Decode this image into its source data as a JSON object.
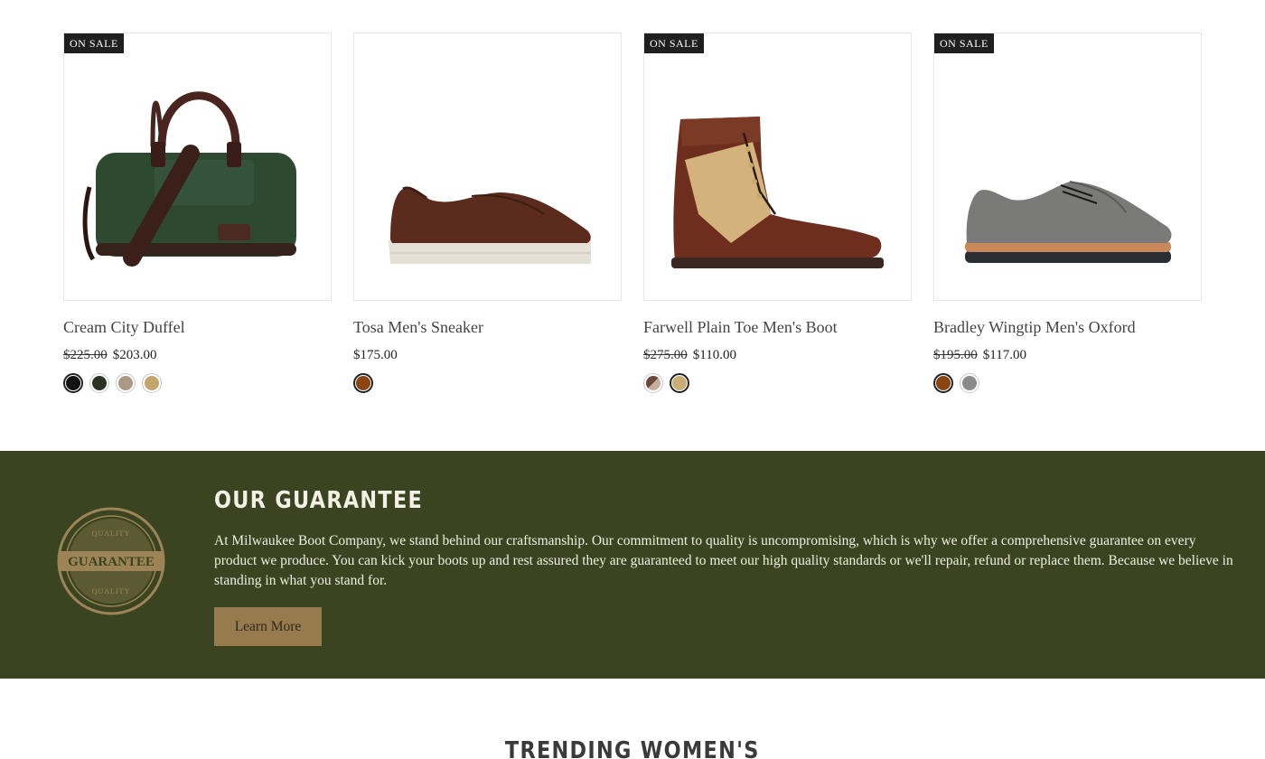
{
  "products": [
    {
      "name": "Cream City Duffel",
      "badge": "ON SALE",
      "old_price": "$225.00",
      "price": "$203.00",
      "image_icon": "duffel-bag-icon",
      "swatches": [
        "#111111",
        "#2b3324",
        "#a89a86",
        "#c3a46a"
      ],
      "selected_swatch": 0
    },
    {
      "name": "Tosa Men's Sneaker",
      "badge": "",
      "old_price": "",
      "price": "$175.00",
      "image_icon": "sneaker-icon",
      "swatches": [
        "#8b4513"
      ],
      "selected_swatch": 0
    },
    {
      "name": "Farwell Plain Toe Men's Boot",
      "badge": "ON SALE",
      "old_price": "$275.00",
      "price": "$110.00",
      "image_icon": "boot-icon",
      "swatches": [
        "#6b4a3e",
        "#c8ae72"
      ],
      "selected_swatch": 1
    },
    {
      "name": "Bradley Wingtip Men's Oxford",
      "badge": "ON SALE",
      "old_price": "$195.00",
      "price": "$117.00",
      "image_icon": "oxford-shoe-icon",
      "swatches": [
        "#8b4513",
        "#8a8a8a"
      ],
      "selected_swatch": 0
    }
  ],
  "guarantee": {
    "title": "OUR GUARANTEE",
    "seal_text": "GUARANTEE",
    "seal_ring_text": "QUALITY",
    "body": "At Milwaukee Boot Company, we stand behind our craftsmanship. Our commitment to quality is uncompromising, which is why we offer a comprehensive guarantee on every product we produce. You can kick your boots up and rest assured they are guaranteed to meet our high quality standards or we'll repair, refund or replace them. Because we believe in standing in what you stand for.",
    "button_label": "Learn More"
  },
  "next_section_title": "TRENDING WOMEN'S",
  "colors": {
    "guarantee_bg": "#3a4420",
    "button_bg": "#987a4f",
    "badge_bg": "#1f1f1f"
  }
}
